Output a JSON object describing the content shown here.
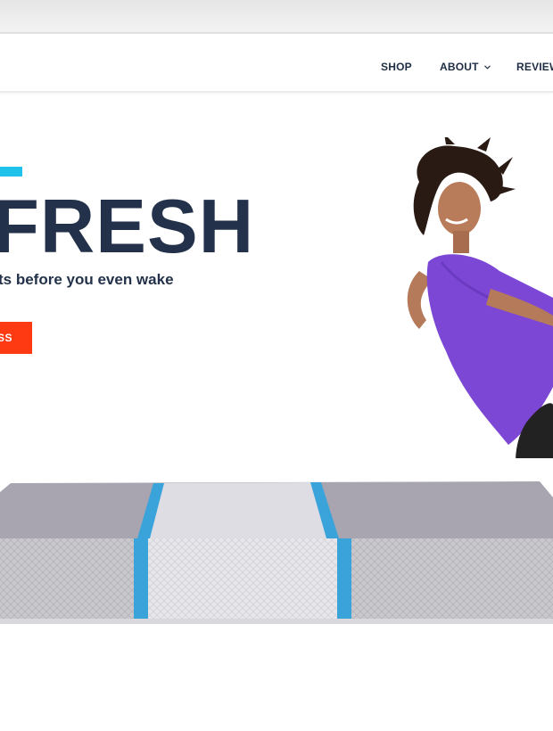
{
  "nav": {
    "items": [
      {
        "label": "SHOP"
      },
      {
        "label": "ABOUT"
      },
      {
        "label": "REVIEW"
      }
    ],
    "about_chevron": "⌄"
  },
  "hero": {
    "headline": "FRESH",
    "subheadline": "ts before you even wake",
    "cta_label": "SS"
  },
  "colors": {
    "accent": "#1ec2ea",
    "navy": "#23324a",
    "cta": "#fe3a12",
    "purple": "#7d47d6"
  },
  "icons": [
    "chevron-down-icon"
  ]
}
